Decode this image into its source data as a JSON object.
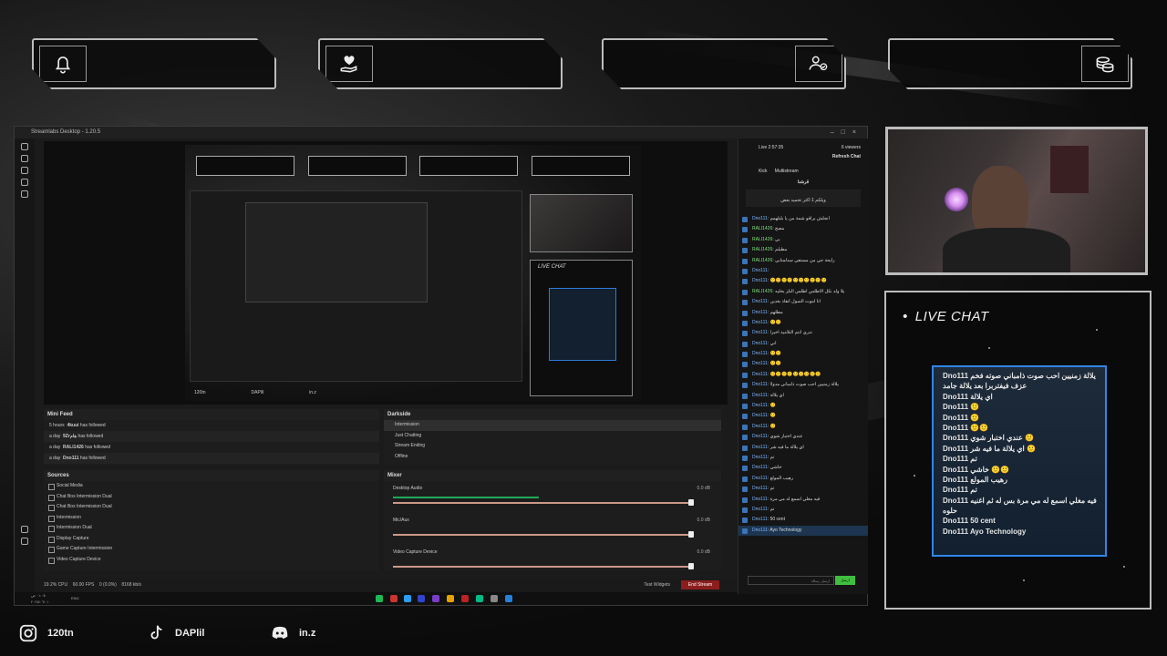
{
  "top_frames": [
    {
      "icon": "bell-icon"
    },
    {
      "icon": "heart-hand-icon"
    },
    {
      "icon": "users-check-icon"
    },
    {
      "icon": "coins-icon"
    }
  ],
  "obs": {
    "title": "Streamlabs Desktop - 1.20.5",
    "mini_feed": {
      "title": "Mini Feed",
      "items": [
        {
          "time": "5 hours",
          "user": "4kuui",
          "action": "has followed"
        },
        {
          "time": "a day",
          "user": "9Zrهام",
          "action": "has followed"
        },
        {
          "time": "a day",
          "user": "RALI1426",
          "action": "has followed"
        },
        {
          "time": "a day",
          "user": "Dno111",
          "action": "has followed"
        }
      ]
    },
    "scene_collection": {
      "title": "Darkside",
      "items": [
        "Intermission",
        "Just Chatting",
        "Stream Ending",
        "Offline"
      ]
    },
    "sources": {
      "title": "Sources",
      "items": [
        "Social Media",
        "Chat Box Intermission Dual",
        "Chat Box Intermission Dual",
        "Intermission",
        "Intermission Dual",
        "Display Capture",
        "Game Capture Intermission",
        "Video Capture Device"
      ]
    },
    "mixer": {
      "title": "Mixer",
      "channels": [
        {
          "name": "Desktop Audio",
          "db": "0.0 dB",
          "level": 0.35
        },
        {
          "name": "Mic/Aux",
          "db": "0.0 dB",
          "level": 0.0
        },
        {
          "name": "Video Capture Device",
          "db": "0.0 dB",
          "level": 0.0
        }
      ]
    },
    "status": {
      "cpu": "19.2% CPU",
      "fps": "60.00 FPS",
      "dropped": "0 (0.0%)",
      "bitrate": "8168 kb/s",
      "test_widgets": "Test Widgets",
      "go_live": "End Stream"
    },
    "taskbar": {
      "time": "٠١:٠٥ ص",
      "date": "٢٠٢٥/٠٦/٠١",
      "lang": "ENG"
    },
    "preview": {
      "mini_chat_title": "LIVE CHAT",
      "socials": [
        "120tn",
        "DAPlil",
        "in.z"
      ]
    },
    "chat": {
      "live_time": "Live 2:57:35",
      "viewers": "6 viewers",
      "refresh": "Refresh Chat",
      "tabs": [
        "Kick",
        "Multistream"
      ],
      "channel": "قرشنا",
      "pinned": "ويلكم 1 اكثر تخميد بعض",
      "messages": [
        {
          "user": "Dno111",
          "text": "انجلش برافو شمة من يا بلبلهمم"
        },
        {
          "user": "RALI1426",
          "text": "مصح"
        },
        {
          "user": "RALI1426",
          "text": "بي"
        },
        {
          "user": "RALI1426",
          "text": "مطبلم"
        },
        {
          "user": "RALI1426",
          "text": "رايحة جي من مستفي سدلمنابي"
        },
        {
          "user": "Dno111",
          "text": ""
        },
        {
          "user": "Dno111",
          "text": "🙂🙂🙂🙂🙂🙂🙂🙂🙂🙂"
        },
        {
          "user": "RALI1426",
          "text": "يلا ولد نكل الاطلس اطلس البلز بخليه"
        },
        {
          "user": "Dno111",
          "text": "انا اموت السول انقاذ بغدين"
        },
        {
          "user": "Dno111",
          "text": "مطلهم"
        },
        {
          "user": "Dno111",
          "text": "🙂🙂"
        },
        {
          "user": "Dno111",
          "text": "ندري انتم التلاميذ اخيرا"
        },
        {
          "user": "Dno111",
          "text": "اني"
        },
        {
          "user": "Dno111",
          "text": "🙂🙂"
        },
        {
          "user": "Dno111",
          "text": "🙂🙂"
        },
        {
          "user": "Dno111",
          "text": "🙂🙂🙂🙂🙂🙂🙂🙂🙂"
        },
        {
          "user": "Dno111",
          "text": "يلالة زمنيين احب صوت ذامباني مدولا"
        },
        {
          "user": "Dno111",
          "text": "اي يلالة"
        },
        {
          "user": "Dno111",
          "text": "🙂"
        },
        {
          "user": "Dno111",
          "text": "🙂"
        },
        {
          "user": "Dno111",
          "text": "🙂"
        },
        {
          "user": "Dno111",
          "text": "عندي اختبار شوي"
        },
        {
          "user": "Dno111",
          "text": "اي يلالة ما فيه شر"
        },
        {
          "user": "Dno111",
          "text": "تم"
        },
        {
          "user": "Dno111",
          "text": "خاشي"
        },
        {
          "user": "Dno111",
          "text": "رهيب المولع"
        },
        {
          "user": "Dno111",
          "text": "تم"
        },
        {
          "user": "Dno111",
          "text": "فيه مغلي اسمع له مي مرة"
        },
        {
          "user": "Dno111",
          "text": "تم"
        },
        {
          "user": "Dno111",
          "text": "50 cent"
        },
        {
          "user": "Dno111",
          "text": "Ayo Technology"
        }
      ],
      "input_placeholder": "ارسل رسالة",
      "send": "ارسل"
    }
  },
  "live_chat": {
    "title": "LIVE CHAT",
    "messages": [
      {
        "user": "Dno111",
        "text": "يلالة زمنيين احب صوت ذامباني صوته فخم"
      },
      {
        "user": "",
        "text": "عزف فيفتربرا بعد يلالة جامد"
      },
      {
        "user": "Dno111",
        "text": "اي يلالة"
      },
      {
        "user": "Dno111",
        "text": "🙂"
      },
      {
        "user": "Dno111",
        "text": "🙂"
      },
      {
        "user": "Dno111",
        "text": "🙂🙂"
      },
      {
        "user": "Dno111",
        "text": "عندي اختبار شوي 🙂"
      },
      {
        "user": "Dno111",
        "text": "اي يلالة ما فيه شر 🙂"
      },
      {
        "user": "Dno111",
        "text": "تم"
      },
      {
        "user": "Dno111",
        "text": "خاشي 🙂🙂"
      },
      {
        "user": "Dno111",
        "text": "رهيب المولع"
      },
      {
        "user": "Dno111",
        "text": "تم"
      },
      {
        "user": "Dno111",
        "text": "فيه مغلي اسمع له مي مرة بس له ثم اغنيه"
      },
      {
        "user": "",
        "text": "حلوه"
      },
      {
        "user": "Dno111",
        "text": "50 cent"
      },
      {
        "user": "Dno111",
        "text": "Ayo Technology"
      }
    ]
  },
  "socials": [
    {
      "icon": "instagram-icon",
      "handle": "120tn"
    },
    {
      "icon": "tiktok-icon",
      "handle": "DAPlil"
    },
    {
      "icon": "discord-icon",
      "handle": "in.z"
    }
  ]
}
